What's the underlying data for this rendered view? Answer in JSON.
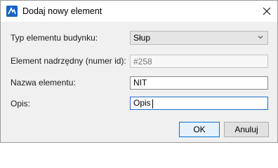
{
  "window": {
    "title": "Dodaj nowy element",
    "app_icon": "ai-app-icon",
    "close_icon": "close-icon"
  },
  "form": {
    "type": {
      "label": "Typ elementu budynku:",
      "value": "Słup"
    },
    "parent": {
      "label": "Element nadrzędny (numer id):",
      "placeholder": "#258",
      "value": ""
    },
    "name": {
      "label": "Nazwa elementu:",
      "value": "NIT"
    },
    "description": {
      "label": "Opis:",
      "value": "Opis"
    }
  },
  "buttons": {
    "ok": "OK",
    "cancel": "Anuluj"
  },
  "colors": {
    "accent": "#0078d7",
    "icon": "#1565c0"
  }
}
